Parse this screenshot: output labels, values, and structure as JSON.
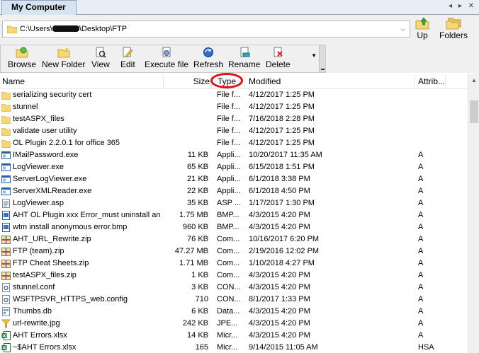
{
  "tab": {
    "title": "My Computer",
    "nav": "◂ ▸ ✕"
  },
  "address": {
    "path_prefix": "C:\\Users\\",
    "path_suffix": "\\Desktop\\FTP"
  },
  "nav_buttons": {
    "up_label": "Up",
    "folders_label": "Folders"
  },
  "toolbar": {
    "browse": "Browse",
    "new_folder": "New Folder",
    "view": "View",
    "edit": "Edit",
    "execute_file": "Execute file",
    "refresh": "Refresh",
    "rename": "Rename",
    "delete": "Delete"
  },
  "columns": {
    "name": "Name",
    "size": "Size",
    "type": "Type",
    "modified": "Modified",
    "attributes": "Attrib..."
  },
  "rows": [
    {
      "icon": "folder",
      "name": "serializing security cert",
      "size": "",
      "type": "File f...",
      "modified": "4/12/2017 1:25 PM",
      "attr": ""
    },
    {
      "icon": "folder",
      "name": "stunnel",
      "size": "",
      "type": "File f...",
      "modified": "4/12/2017 1:25 PM",
      "attr": ""
    },
    {
      "icon": "folder",
      "name": "testASPX_files",
      "size": "",
      "type": "File f...",
      "modified": "7/16/2018 2:28 PM",
      "attr": ""
    },
    {
      "icon": "folder",
      "name": "validate user utility",
      "size": "",
      "type": "File f...",
      "modified": "4/12/2017 1:25 PM",
      "attr": ""
    },
    {
      "icon": "folder",
      "name": "OL Plugin 2.2.0.1 for office 365",
      "size": "",
      "type": "File f...",
      "modified": "4/12/2017 1:25 PM",
      "attr": ""
    },
    {
      "icon": "exe",
      "name": "IMailPassword.exe",
      "size": "11 KB",
      "type": "Appli...",
      "modified": "10/20/2017 11:35 AM",
      "attr": "A"
    },
    {
      "icon": "exe",
      "name": "LogViewer.exe",
      "size": "65 KB",
      "type": "Appli...",
      "modified": "6/15/2018 1:51 PM",
      "attr": "A"
    },
    {
      "icon": "exe",
      "name": "ServerLogViewer.exe",
      "size": "21 KB",
      "type": "Appli...",
      "modified": "6/1/2018 3:38 PM",
      "attr": "A"
    },
    {
      "icon": "exe",
      "name": "ServerXMLReader.exe",
      "size": "22 KB",
      "type": "Appli...",
      "modified": "6/1/2018 4:50 PM",
      "attr": "A"
    },
    {
      "icon": "doc",
      "name": "LogViewer.asp",
      "size": "35 KB",
      "type": "ASP ...",
      "modified": "1/17/2017 1:30 PM",
      "attr": "A"
    },
    {
      "icon": "bmp",
      "name": "AHT OL Plugin xxx Error_must uninstall an...",
      "size": "1.75 MB",
      "type": "BMP...",
      "modified": "4/3/2015 4:20 PM",
      "attr": "A"
    },
    {
      "icon": "bmp",
      "name": "wtm install anonymous error.bmp",
      "size": "960 KB",
      "type": "BMP...",
      "modified": "4/3/2015 4:20 PM",
      "attr": "A"
    },
    {
      "icon": "zip",
      "name": "AHT_URL_Rewrite.zip",
      "size": "76 KB",
      "type": "Com...",
      "modified": "10/16/2017 6:20 PM",
      "attr": "A"
    },
    {
      "icon": "zip",
      "name": "FTP (team).zip",
      "size": "47.27 MB",
      "type": "Com...",
      "modified": "2/19/2016 12:02 PM",
      "attr": "A"
    },
    {
      "icon": "zip",
      "name": "FTP Cheat Sheets.zip",
      "size": "1.71 MB",
      "type": "Com...",
      "modified": "1/10/2018 4:27 PM",
      "attr": "A"
    },
    {
      "icon": "zip",
      "name": "testASPX_files.zip",
      "size": "1 KB",
      "type": "Com...",
      "modified": "4/3/2015 4:20 PM",
      "attr": "A"
    },
    {
      "icon": "conf",
      "name": "stunnel.conf",
      "size": "3 KB",
      "type": "CON...",
      "modified": "4/3/2015 4:20 PM",
      "attr": "A"
    },
    {
      "icon": "conf",
      "name": "WSFTPSVR_HTTPS_web.config",
      "size": "710",
      "type": "CON...",
      "modified": "8/1/2017 1:33 PM",
      "attr": "A"
    },
    {
      "icon": "db",
      "name": "Thumbs.db",
      "size": "6 KB",
      "type": "Data...",
      "modified": "4/3/2015 4:20 PM",
      "attr": "A"
    },
    {
      "icon": "jpg",
      "name": "url-rewrite.jpg",
      "size": "242 KB",
      "type": "JPE...",
      "modified": "4/3/2015 4:20 PM",
      "attr": "A"
    },
    {
      "icon": "xlsx",
      "name": "AHT Errors.xlsx",
      "size": "14 KB",
      "type": "Micr...",
      "modified": "4/3/2015 4:20 PM",
      "attr": "A"
    },
    {
      "icon": "xlsx",
      "name": "~$AHT Errors.xlsx",
      "size": "165",
      "type": "Micr...",
      "modified": "9/14/2015 11:05 AM",
      "attr": "HSA"
    }
  ],
  "colors": {
    "folder": "#f7d774",
    "annotation_circle": "#e01010"
  }
}
